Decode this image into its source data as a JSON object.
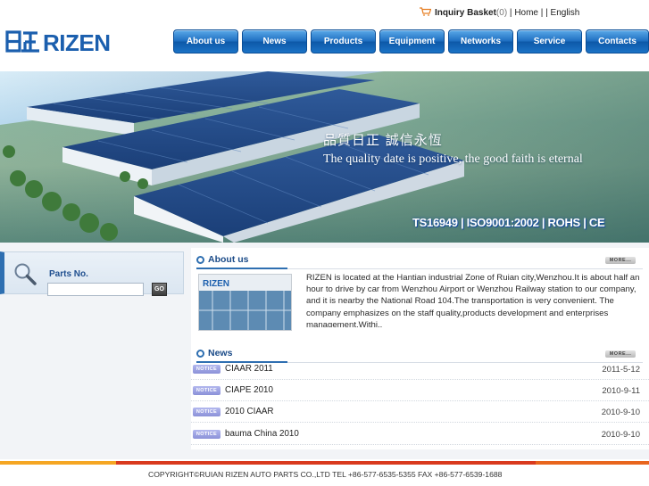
{
  "brand": {
    "logo_text": "RIZEN",
    "logo_color": "#1b5fae"
  },
  "toplinks": {
    "basket_label": "Inquiry Basket",
    "basket_count": "(0)",
    "sep1": " | ",
    "home": "Home",
    "sep2": " |   | ",
    "english": "English"
  },
  "nav": {
    "items": [
      {
        "label": "About us"
      },
      {
        "label": "News"
      },
      {
        "label": "Products"
      },
      {
        "label": "Equipment"
      },
      {
        "label": "Networks"
      },
      {
        "label": "Service"
      },
      {
        "label": "Contacts"
      }
    ]
  },
  "banner": {
    "chinese": "品質日正  誠信永恆",
    "english": "The quality date is positive, the good faith is eternal",
    "certs": "TS16949 | ISO9001:2002 | ROHS | CE"
  },
  "search": {
    "label": "Parts No.",
    "value": "",
    "go": "GO"
  },
  "about": {
    "title": "About us",
    "more": "MORE...",
    "text": "RIZEN is located at the Hantian industrial Zone of Ruian city,Wenzhou.It is about half an hour to drive by car from Wenzhou Airport or Wenzhou Railway station to our company, and it is nearby the National Road 104.The transportation is very convenient. The company emphasizes on the staff quality,products development and enterprises management.Withi..",
    "thumb_logo": "RIZEN"
  },
  "news": {
    "title": "News",
    "more": "MORE...",
    "tag": "NOTICE",
    "items": [
      {
        "title": "CIAAR 2011",
        "date": "2011-5-12"
      },
      {
        "title": "CIAPE 2010",
        "date": "2010-9-11"
      },
      {
        "title": "2010 CIAAR",
        "date": "2010-9-10"
      },
      {
        "title": "bauma China 2010",
        "date": "2010-9-10"
      }
    ]
  },
  "footer": {
    "text": "COPYRIGHT©RUIAN RIZEN AUTO PARTS CO.,LTD  TEL +86-577-6535-5355 FAX +86-577-6539-1688",
    "stripe_colors": [
      "#f5a623",
      "#d93a1e",
      "#e8651d"
    ]
  }
}
